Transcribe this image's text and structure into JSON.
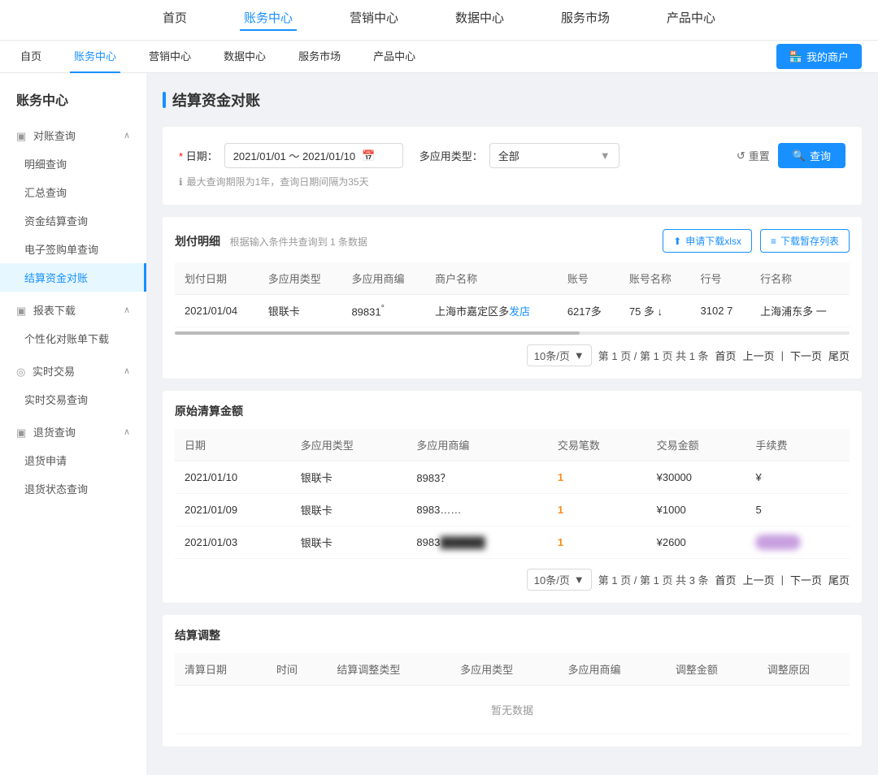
{
  "topNav": {
    "items": [
      {
        "label": "首页",
        "active": false
      },
      {
        "label": "账务中心",
        "active": true
      },
      {
        "label": "营销中心",
        "active": false
      },
      {
        "label": "数据中心",
        "active": false
      },
      {
        "label": "服务市场",
        "active": false
      },
      {
        "label": "产品中心",
        "active": false
      }
    ]
  },
  "subNav": {
    "items": [
      {
        "label": "自页",
        "active": false
      },
      {
        "label": "账务中心",
        "active": true
      },
      {
        "label": "营销中心",
        "active": false
      },
      {
        "label": "数据中心",
        "active": false
      },
      {
        "label": "服务市场",
        "active": false
      },
      {
        "label": "产品中心",
        "active": false
      }
    ],
    "myMerchantLabel": "我的商户"
  },
  "sidebar": {
    "title": "账务中心",
    "groups": [
      {
        "label": "对账查询",
        "icon": "∧",
        "items": [
          {
            "label": "明细查询",
            "active": false
          },
          {
            "label": "汇总查询",
            "active": false
          },
          {
            "label": "资金结算查询",
            "active": false
          },
          {
            "label": "电子签购单查询",
            "active": false
          },
          {
            "label": "结算资金对账",
            "active": true
          }
        ]
      },
      {
        "label": "报表下载",
        "icon": "∧",
        "items": [
          {
            "label": "个性化对账单下载",
            "active": false
          }
        ]
      },
      {
        "label": "实时交易",
        "icon": "∧",
        "items": [
          {
            "label": "实时交易查询",
            "active": false
          }
        ]
      },
      {
        "label": "退货查询",
        "icon": "∧",
        "items": [
          {
            "label": "退货申请",
            "active": false
          },
          {
            "label": "退货状态查询",
            "active": false
          }
        ]
      }
    ]
  },
  "page": {
    "title": "结算资金对账",
    "search": {
      "dateLabel": "日期：",
      "dateValue": "2021/01/01 ～ 2021/01/10",
      "appTypeLabel": "多应用类型：",
      "appTypeValue": "全部",
      "resetLabel": "重置",
      "searchLabel": "查询",
      "hintText": "最大查询期限为1年，查询日期间隔为35天"
    },
    "paymentDetail": {
      "title": "划付明细",
      "subtitle": "根据输入条件共查询到 1 条数据",
      "downloadXlsx": "申请下载xlsx",
      "downloadList": "下载暂存列表",
      "columns": [
        "划付日期",
        "多应用类型",
        "多应用商编",
        "商户名称",
        "账号",
        "账号名称",
        "行号",
        "行名称"
      ],
      "rows": [
        {
          "date": "2021/01/04",
          "appType": "银联卡",
          "appCode": "89831°",
          "merchantName": "上海市嘉定区多",
          "merchantNameSuffix": "发店",
          "account": "6217多",
          "accountName": "75 多",
          "bankCode": "3102",
          "bankCodeSuffix": "7",
          "bankName": "上海浦东多",
          "bankNameSuffix": "一"
        }
      ],
      "pagination": {
        "perPage": "10条/页",
        "info": "第 1 页 / 第 1 页 共 1 条 首页 上一页 | 下一页 尾页"
      }
    },
    "clearingAmount": {
      "title": "原始清算金额",
      "columns": [
        "日期",
        "多应用类型",
        "多应用商编",
        "交易笔数",
        "交易金额",
        "手续费"
      ],
      "rows": [
        {
          "date": "2021/01/10",
          "appType": "银联卡",
          "appCode": "8983",
          "appCodeSuffix": "？",
          "count": "1",
          "amount": "¥30000",
          "fee": "¥"
        },
        {
          "date": "2021/01/09",
          "appType": "银联卡",
          "appCode": "8983",
          "appCodeSuffix": "……",
          "count": "1",
          "amount": "¥1000",
          "fee": "5"
        },
        {
          "date": "2021/01/03",
          "appType": "银联卡",
          "appCode": "8983",
          "appCodeSuffix": "blurred",
          "count": "1",
          "amount": "¥2600",
          "fee": "blurred"
        }
      ],
      "pagination": {
        "perPage": "10条/页",
        "info": "第 1 页 / 第 1 页 共 3 条 首页 上一页 | 下一页 尾页"
      }
    },
    "adjustment": {
      "title": "结算调整",
      "columns": [
        "清算日期",
        "时间",
        "结算调整类型",
        "多应用类型",
        "多应用商编",
        "调整金额",
        "调整原因"
      ],
      "noData": "暂无数据"
    }
  }
}
